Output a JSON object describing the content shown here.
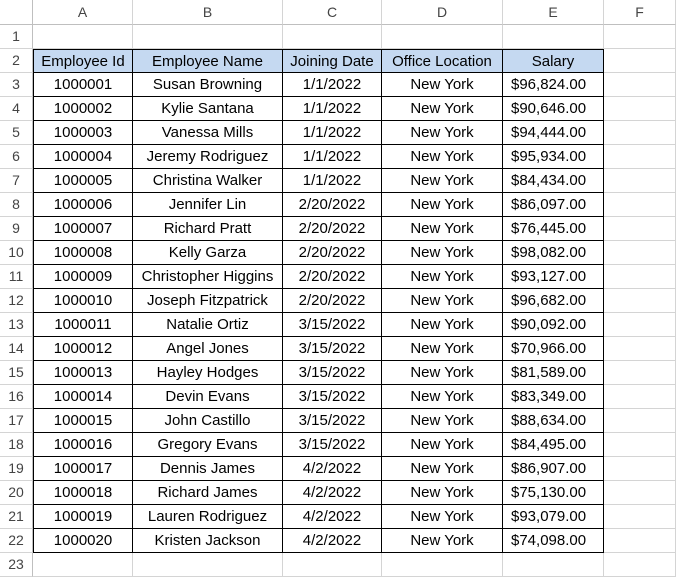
{
  "columns": [
    "A",
    "B",
    "C",
    "D",
    "E",
    "F"
  ],
  "header_row_number": "2",
  "headers": {
    "id": "Employee Id",
    "name": "Employee Name",
    "date": "Joining Date",
    "location": "Office Location",
    "salary": "Salary"
  },
  "empty_rows": [
    "1",
    "23"
  ],
  "rows": [
    {
      "n": "3",
      "id": "1000001",
      "name": "Susan Browning",
      "date": "1/1/2022",
      "location": "New York",
      "salary": "$96,824.00"
    },
    {
      "n": "4",
      "id": "1000002",
      "name": "Kylie Santana",
      "date": "1/1/2022",
      "location": "New York",
      "salary": "$90,646.00"
    },
    {
      "n": "5",
      "id": "1000003",
      "name": "Vanessa Mills",
      "date": "1/1/2022",
      "location": "New York",
      "salary": "$94,444.00"
    },
    {
      "n": "6",
      "id": "1000004",
      "name": "Jeremy Rodriguez",
      "date": "1/1/2022",
      "location": "New York",
      "salary": "$95,934.00"
    },
    {
      "n": "7",
      "id": "1000005",
      "name": "Christina Walker",
      "date": "1/1/2022",
      "location": "New York",
      "salary": "$84,434.00"
    },
    {
      "n": "8",
      "id": "1000006",
      "name": "Jennifer Lin",
      "date": "2/20/2022",
      "location": "New York",
      "salary": "$86,097.00"
    },
    {
      "n": "9",
      "id": "1000007",
      "name": "Richard Pratt",
      "date": "2/20/2022",
      "location": "New York",
      "salary": "$76,445.00"
    },
    {
      "n": "10",
      "id": "1000008",
      "name": "Kelly Garza",
      "date": "2/20/2022",
      "location": "New York",
      "salary": "$98,082.00"
    },
    {
      "n": "11",
      "id": "1000009",
      "name": "Christopher Higgins",
      "date": "2/20/2022",
      "location": "New York",
      "salary": "$93,127.00"
    },
    {
      "n": "12",
      "id": "1000010",
      "name": "Joseph Fitzpatrick",
      "date": "2/20/2022",
      "location": "New York",
      "salary": "$96,682.00"
    },
    {
      "n": "13",
      "id": "1000011",
      "name": "Natalie Ortiz",
      "date": "3/15/2022",
      "location": "New York",
      "salary": "$90,092.00"
    },
    {
      "n": "14",
      "id": "1000012",
      "name": "Angel Jones",
      "date": "3/15/2022",
      "location": "New York",
      "salary": "$70,966.00"
    },
    {
      "n": "15",
      "id": "1000013",
      "name": "Hayley Hodges",
      "date": "3/15/2022",
      "location": "New York",
      "salary": "$81,589.00"
    },
    {
      "n": "16",
      "id": "1000014",
      "name": "Devin Evans",
      "date": "3/15/2022",
      "location": "New York",
      "salary": "$83,349.00"
    },
    {
      "n": "17",
      "id": "1000015",
      "name": "John Castillo",
      "date": "3/15/2022",
      "location": "New York",
      "salary": "$88,634.00"
    },
    {
      "n": "18",
      "id": "1000016",
      "name": "Gregory Evans",
      "date": "3/15/2022",
      "location": "New York",
      "salary": "$84,495.00"
    },
    {
      "n": "19",
      "id": "1000017",
      "name": "Dennis James",
      "date": "4/2/2022",
      "location": "New York",
      "salary": "$86,907.00"
    },
    {
      "n": "20",
      "id": "1000018",
      "name": "Richard James",
      "date": "4/2/2022",
      "location": "New York",
      "salary": "$75,130.00"
    },
    {
      "n": "21",
      "id": "1000019",
      "name": "Lauren Rodriguez",
      "date": "4/2/2022",
      "location": "New York",
      "salary": "$93,079.00"
    },
    {
      "n": "22",
      "id": "1000020",
      "name": "Kristen Jackson",
      "date": "4/2/2022",
      "location": "New York",
      "salary": "$74,098.00"
    }
  ]
}
